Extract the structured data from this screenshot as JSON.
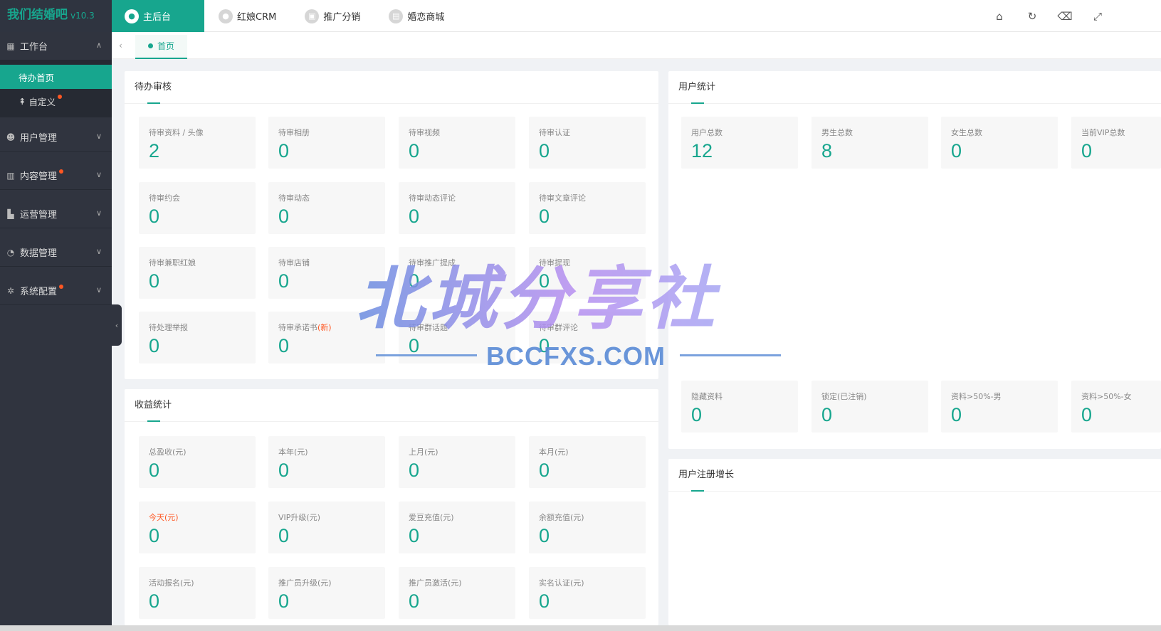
{
  "brand": {
    "name": "我们结婚吧",
    "version": "v10.3"
  },
  "topnav": [
    {
      "label": "主后台",
      "active": true,
      "icon": "user-icon"
    },
    {
      "label": "红娘CRM",
      "active": false,
      "icon": "crm-icon"
    },
    {
      "label": "推广分销",
      "active": false,
      "icon": "chart-icon"
    },
    {
      "label": "婚恋商城",
      "active": false,
      "icon": "shop-icon"
    }
  ],
  "toolbar": [
    "home-icon",
    "refresh-icon",
    "clear-icon",
    "fullscreen-icon"
  ],
  "sidebar": {
    "workbench": {
      "label": "工作台",
      "items": [
        {
          "label": "待办首页",
          "active": true
        },
        {
          "label": "自定义",
          "badge": true
        }
      ]
    },
    "groups": [
      {
        "label": "用户管理",
        "badge": false
      },
      {
        "label": "内容管理",
        "badge": true
      },
      {
        "label": "运营管理",
        "badge": false
      },
      {
        "label": "数据管理",
        "badge": false
      },
      {
        "label": "系统配置",
        "badge": true
      }
    ]
  },
  "breadcrumb": {
    "tab": "首页"
  },
  "pending": {
    "title": "待办审核",
    "cards": [
      {
        "label": "待审资料 / 头像",
        "value": "2"
      },
      {
        "label": "待审相册",
        "value": "0"
      },
      {
        "label": "待审视频",
        "value": "0"
      },
      {
        "label": "待审认证",
        "value": "0"
      },
      {
        "label": "待审约会",
        "value": "0"
      },
      {
        "label": "待审动态",
        "value": "0"
      },
      {
        "label": "待审动态评论",
        "value": "0"
      },
      {
        "label": "待审文章评论",
        "value": "0"
      },
      {
        "label": "待审兼职红娘",
        "value": "0"
      },
      {
        "label": "待审店铺",
        "value": "0"
      },
      {
        "label": "待审推广提成",
        "value": "0"
      },
      {
        "label": "待审提现",
        "value": "0"
      },
      {
        "label": "待处理举报",
        "value": "0"
      },
      {
        "label": "待审承诺书",
        "label_extra": "(新)",
        "value": "0"
      },
      {
        "label": "待审群话题",
        "value": "0"
      },
      {
        "label": "待审群评论",
        "value": "0"
      }
    ]
  },
  "income": {
    "title": "收益统计",
    "cards": [
      {
        "label": "总盈收(元)",
        "value": "0"
      },
      {
        "label": "本年(元)",
        "value": "0"
      },
      {
        "label": "上月(元)",
        "value": "0"
      },
      {
        "label": "本月(元)",
        "value": "0"
      },
      {
        "label": "今天(元)",
        "value": "0",
        "highlight": true
      },
      {
        "label": "VIP升级(元)",
        "value": "0"
      },
      {
        "label": "爱豆充值(元)",
        "value": "0"
      },
      {
        "label": "余额充值(元)",
        "value": "0"
      },
      {
        "label": "活动报名(元)",
        "value": "0"
      },
      {
        "label": "推广员升级(元)",
        "value": "0"
      },
      {
        "label": "推广员激活(元)",
        "value": "0"
      },
      {
        "label": "实名认证(元)",
        "value": "0"
      }
    ]
  },
  "users": {
    "title": "用户统计",
    "cards": [
      {
        "label": "用户总数",
        "value": "12"
      },
      {
        "label": "男生总数",
        "value": "8"
      },
      {
        "label": "女生总数",
        "value": "0"
      },
      {
        "label": "当前VIP总数",
        "value": "0"
      },
      {
        "label": "隐藏资料",
        "value": "0"
      },
      {
        "label": "锁定(已注销)",
        "value": "0"
      },
      {
        "label": "资料>50%-男",
        "value": "0"
      },
      {
        "label": "资料>50%-女",
        "value": "0"
      }
    ]
  },
  "growth": {
    "title": "用户注册增长"
  },
  "watermark": {
    "main": "北城分享社",
    "sub": "BCCFXS.COM"
  },
  "colors": {
    "accent": "#17a68e",
    "sidebar": "#30343f",
    "alert": "#ff5722"
  }
}
